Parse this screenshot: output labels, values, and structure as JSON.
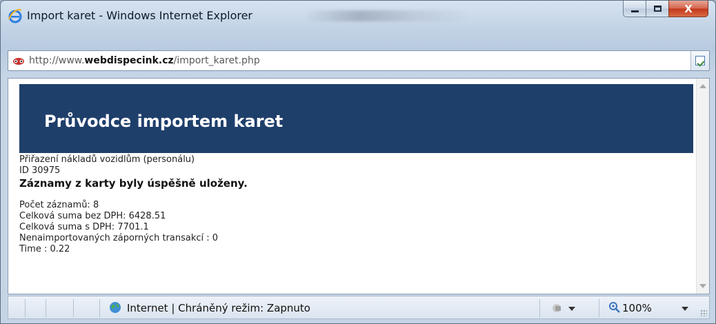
{
  "window": {
    "title": "Import karet - Windows Internet Explorer",
    "controls": {
      "minimize": "",
      "maximize": "",
      "close": "X"
    }
  },
  "address": {
    "url_prefix": "http://www.",
    "url_domain": "webdispecink.cz",
    "url_path": "/import_karet.php"
  },
  "page": {
    "banner_title": "Průvodce importem karet",
    "lines": {
      "subtitle": "Přiřazení nákladů vozidlům (personálu)",
      "id": "ID 30975",
      "success": "Záznamy z karty byly úspěšně uloženy.",
      "count": "Počet záznamů: 8",
      "sum_without_vat": "Celková suma bez DPH: 6428.51",
      "sum_with_vat": "Celková suma s DPH: 7701.1",
      "non_imported": "Nenaimportovaných záporných transakcí : 0",
      "time": "Time : 0.22"
    }
  },
  "statusbar": {
    "zone_text": "Internet | Chráněný režim: Zapnuto",
    "zoom": "100%"
  },
  "colors": {
    "banner_bg": "#1f3f6b",
    "banner_text": "#ffffff",
    "close_button": "#c2361a"
  },
  "icons": {
    "app": "ie-logo-icon",
    "site": "site-favicon-icon",
    "go": "compatibility-view-icon",
    "zone": "globe-icon",
    "security": "protected-mode-icon",
    "zoom": "magnifier-icon"
  }
}
